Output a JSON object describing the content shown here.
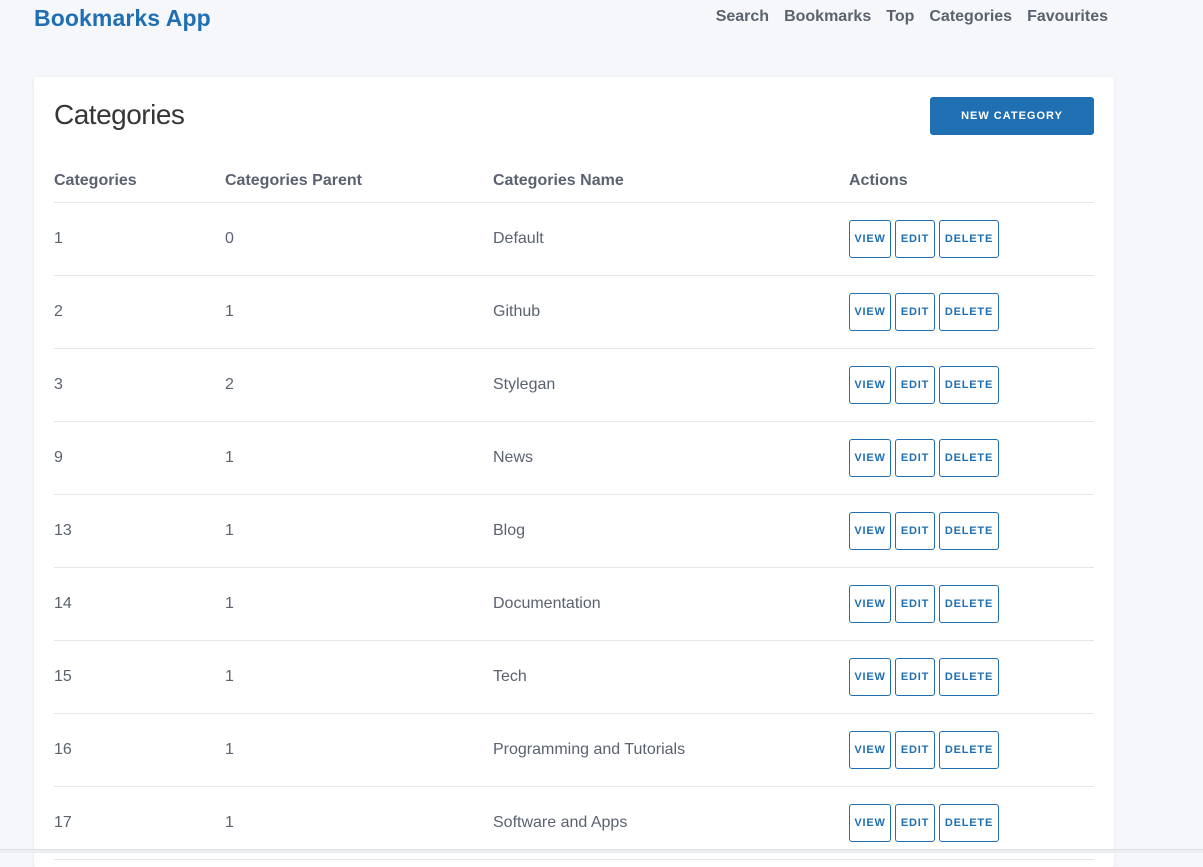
{
  "header": {
    "brand": "Bookmarks App",
    "nav": [
      "Search",
      "Bookmarks",
      "Top",
      "Categories",
      "Favourites"
    ]
  },
  "page": {
    "title": "Categories",
    "new_button": "NEW CATEGORY"
  },
  "table": {
    "columns": [
      "Categories",
      "Categories Parent",
      "Categories Name",
      "Actions"
    ],
    "action_labels": {
      "view": "VIEW",
      "edit": "EDIT",
      "delete": "DELETE"
    },
    "rows": [
      {
        "id": "1",
        "parent": "0",
        "name": "Default"
      },
      {
        "id": "2",
        "parent": "1",
        "name": "Github"
      },
      {
        "id": "3",
        "parent": "2",
        "name": "Stylegan"
      },
      {
        "id": "9",
        "parent": "1",
        "name": "News"
      },
      {
        "id": "13",
        "parent": "1",
        "name": "Blog"
      },
      {
        "id": "14",
        "parent": "1",
        "name": "Documentation"
      },
      {
        "id": "15",
        "parent": "1",
        "name": "Tech"
      },
      {
        "id": "16",
        "parent": "1",
        "name": "Programming and Tutorials"
      },
      {
        "id": "17",
        "parent": "1",
        "name": "Software and Apps"
      }
    ]
  },
  "colors": {
    "accent": "#1f6fb2",
    "text": "#5a6270",
    "background": "#f5f7fa"
  }
}
